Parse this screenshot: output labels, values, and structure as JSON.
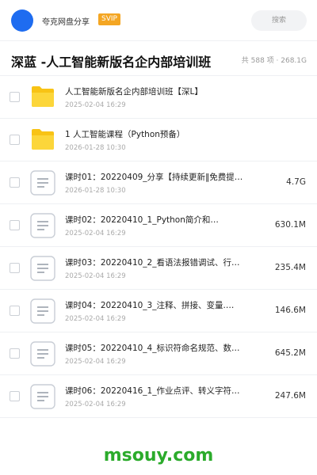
{
  "header": {
    "share_name": "夸克网盘分享",
    "badge": "SVIP",
    "search_placeholder": "搜索"
  },
  "colors": {
    "accent": "#1e6cf0",
    "badge": "#f4a623",
    "folder": "#f8c315",
    "watermark": "#2bab2b"
  },
  "folder": {
    "title": "深蓝 -人工智能新版名企内部培训班",
    "meta": "共 588 项 · 268.1G"
  },
  "files": [
    {
      "type": "folder",
      "icon": "folder-icon",
      "name": "人工智能新版名企内部培训班【深L】",
      "date": "2025-02-04 16:29",
      "size": ""
    },
    {
      "type": "folder",
      "icon": "folder-icon",
      "name": "1 人工智能课程（Python预备）",
      "date": "2026-01-28 10:30",
      "size": ""
    },
    {
      "type": "doc",
      "icon": "document-icon",
      "name": "课时01：20220409_分享【持续更新‖免费提…",
      "date": "2026-01-28 10:30",
      "size": "4.7G"
    },
    {
      "type": "doc",
      "icon": "document-icon",
      "name": "课时02：20220410_1_Python简介和…",
      "date": "2025-02-04 16:29",
      "size": "630.1M"
    },
    {
      "type": "doc",
      "icon": "document-icon",
      "name": "课时03：20220410_2_看语法报错调试、行…",
      "date": "2025-02-04 16:29",
      "size": "235.4M"
    },
    {
      "type": "doc",
      "icon": "document-icon",
      "name": "课时04：20220410_3_注释、拼接、变量.…",
      "date": "2025-02-04 16:29",
      "size": "146.6M"
    },
    {
      "type": "doc",
      "icon": "document-icon",
      "name": "课时05：20220410_4_标识符命名规范、数…",
      "date": "2025-02-04 16:29",
      "size": "645.2M"
    },
    {
      "type": "doc",
      "icon": "document-icon",
      "name": "课时06：20220416_1_作业点评、转义字符…",
      "date": "2025-02-04 16:29",
      "size": "247.6M"
    }
  ],
  "watermark": "msouy.com"
}
